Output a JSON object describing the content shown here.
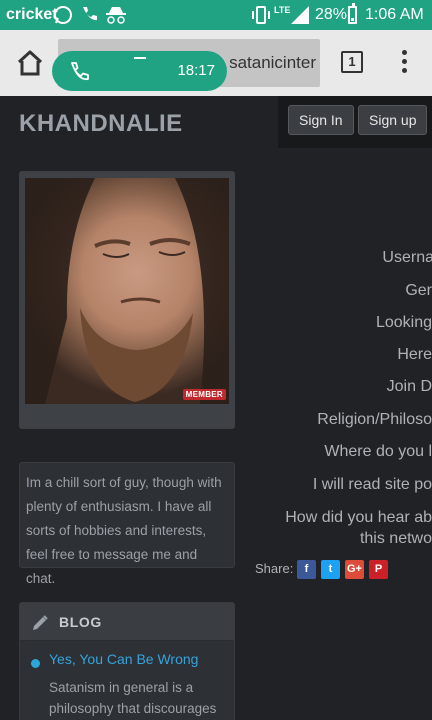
{
  "status_bar": {
    "carrier": "cricket",
    "network": "LTE",
    "battery": "28%",
    "time": "1:06 AM"
  },
  "browser": {
    "url_text": "satanicinter",
    "tab_count": "1"
  },
  "call_overlay": {
    "timer": "18:17"
  },
  "profile": {
    "username": "KHANDNALIE",
    "sign_in_label": "Sign In",
    "sign_up_label": "Sign up",
    "badge": "MEMBER",
    "bio": "Im a chill sort of guy, though with plenty of enthusiasm. I have all sorts of hobbies and interests, feel free to message me and chat."
  },
  "details": [
    {
      "label": "Userna"
    },
    {
      "label": "Ger"
    },
    {
      "label": "Looking"
    },
    {
      "label": "Here"
    },
    {
      "label": "Join D"
    },
    {
      "label": "Religion/Philoso"
    },
    {
      "label": "Where do you l"
    },
    {
      "label": "I will read site po"
    },
    {
      "label": "How did you hear ab"
    },
    {
      "label": "this netwo"
    }
  ],
  "share": {
    "label": "Share:",
    "buttons": [
      {
        "icon": "facebook-icon",
        "glyph": "f",
        "color": "#3b5998"
      },
      {
        "icon": "twitter-icon",
        "glyph": "t",
        "color": "#1da1f2"
      },
      {
        "icon": "google-plus-icon",
        "glyph": "G+",
        "color": "#dd4b39"
      },
      {
        "icon": "pinterest-icon",
        "glyph": "P",
        "color": "#cb2027"
      }
    ]
  },
  "blog": {
    "heading": "BLOG",
    "post_title": "Yes, You Can Be Wrong",
    "post_excerpt": "Satanism in general is a philosophy that discourages"
  }
}
